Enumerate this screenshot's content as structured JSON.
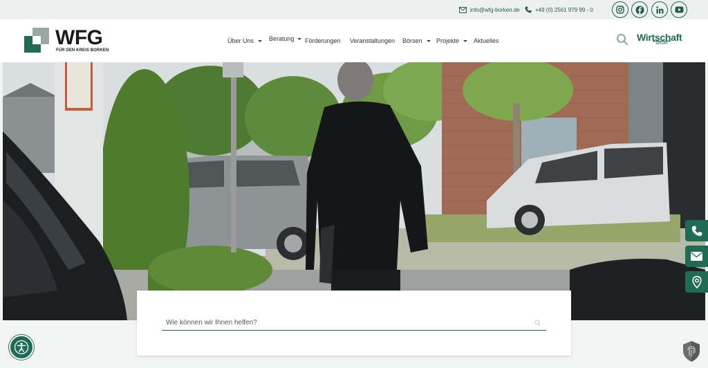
{
  "topbar": {
    "email": "info@wfg-borken.de",
    "phone": "+49 (0) 2561 979 99 - 0",
    "social": [
      "instagram-icon",
      "facebook-icon",
      "linkedin-icon",
      "youtube-icon"
    ]
  },
  "logo": {
    "title": "WFG",
    "subtitle": "FÜR DEN KREIS BORKEN"
  },
  "nav": {
    "items": [
      {
        "label": "Über Uns",
        "dropdown": true
      },
      {
        "label": "Beratung",
        "dropdown": true
      },
      {
        "label": "Förderungen",
        "dropdown": false
      },
      {
        "label": "Veranstaltungen",
        "dropdown": false
      },
      {
        "label": "Börsen",
        "dropdown": true
      },
      {
        "label": "Projekte",
        "dropdown": true
      },
      {
        "label": "Aktuelles",
        "dropdown": false
      }
    ]
  },
  "brand_badge": {
    "main": "Wirtschaft",
    "sub": "aktuell"
  },
  "search": {
    "placeholder": "Wie können wir Ihnen helfen?"
  },
  "side_buttons": [
    "phone-icon",
    "mail-icon",
    "location-icon"
  ],
  "colors": {
    "accent": "#1f6b56",
    "topbar_bg": "#eef0ef",
    "page_bg": "#f2f3f3"
  }
}
